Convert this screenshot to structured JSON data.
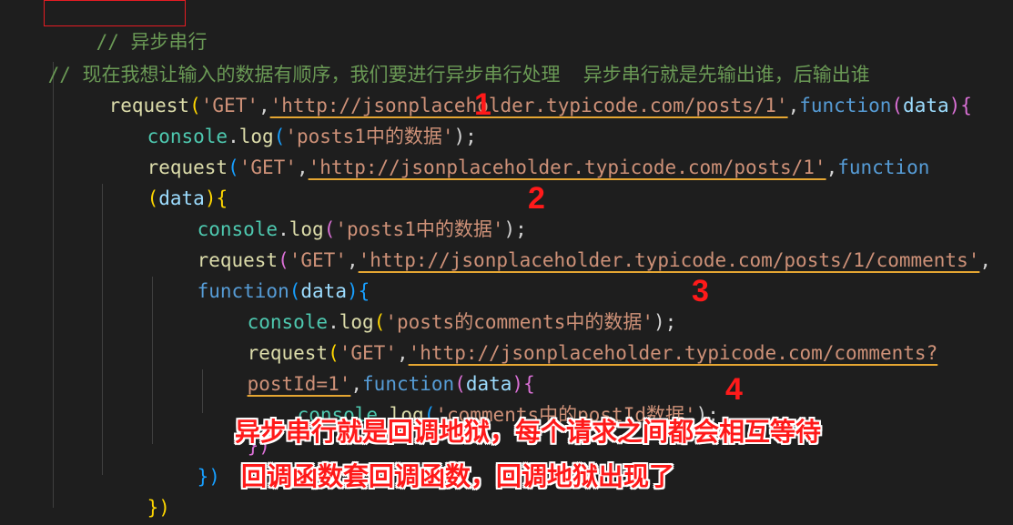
{
  "editor": {
    "title_comment": "// 异步串行",
    "desc_comment": "// 现在我想让输入的数据有顺序，我们要进行异步串行处理  异步串行就是先输出谁，后输出谁",
    "lines": {
      "l1_func": "request",
      "l1_open": "(",
      "l1_method": "'GET'",
      "l1_comma": ",",
      "l1_url": "'http://jsonplaceholder.typicode.com/posts/1'",
      "l1_comma2": ",",
      "l1_kw": "function",
      "l1_p_open": "(",
      "l1_param": "data",
      "l1_p_close": ")",
      "l1_brace": "{",
      "l2_obj": "console",
      "l2_dot": ".",
      "l2_func": "log",
      "l2_open": "(",
      "l2_str": "'posts1中的数据'",
      "l2_close": ");",
      "l3_func": "request",
      "l3_open": "(",
      "l3_method": "'GET'",
      "l3_comma": ",",
      "l3_url": "'http://jsonplaceholder.typicode.com/posts/1'",
      "l3_comma2": ",",
      "l3_kw": "function",
      "l4_p_open": "(",
      "l4_param": "data",
      "l4_p_close": ")",
      "l4_brace": "{",
      "l5_obj": "console",
      "l5_dot": ".",
      "l5_func": "log",
      "l5_open": "(",
      "l5_str": "'posts1中的数据'",
      "l5_close": ");",
      "l6_func": "request",
      "l6_open": "(",
      "l6_method": "'GET'",
      "l6_comma": ",",
      "l6_url": "'http://jsonplaceholder.typicode.com/posts/1/comments'",
      "l6_comma2": ",",
      "l7_kw": "function",
      "l7_p_open": "(",
      "l7_param": "data",
      "l7_p_close": ")",
      "l7_brace": "{",
      "l8_obj": "console",
      "l8_dot": ".",
      "l8_func": "log",
      "l8_open": "(",
      "l8_str": "'posts的comments中的数据'",
      "l8_close": ");",
      "l9_func": "request",
      "l9_open": "(",
      "l9_method": "'GET'",
      "l9_comma": ",",
      "l9_url": "'http://jsonplaceholder.typicode.com/comments?",
      "l10_url": "postId=1'",
      "l10_comma": ",",
      "l10_kw": "function",
      "l10_p_open": "(",
      "l10_param": "data",
      "l10_p_close": ")",
      "l10_brace": "{",
      "l11_obj": "console",
      "l11_dot": ".",
      "l11_func": "log",
      "l11_open": "(",
      "l11_str": "'comments中的postId数据'",
      "l11_close": ");",
      "l12_close": "})",
      "l13_close": "})",
      "l14_close": "})",
      "l15_close": "})"
    }
  },
  "markers": {
    "m1": "1",
    "m2": "2",
    "m3": "3",
    "m4": "4"
  },
  "annotations": {
    "line1": "异步串行就是回调地狱，每个请求之间都会相互等待",
    "line2": "回调函数套回调函数，回调地狱出现了"
  },
  "colors": {
    "background": "#1e1e1e",
    "comment": "#6a9955",
    "function": "#dcdcaa",
    "string": "#ce9178",
    "keyword": "#569cd6",
    "parameter": "#9cdcfe",
    "object": "#4ec9b0",
    "annotation": "#ff1a1a",
    "highlight_box": "#e51c23"
  }
}
